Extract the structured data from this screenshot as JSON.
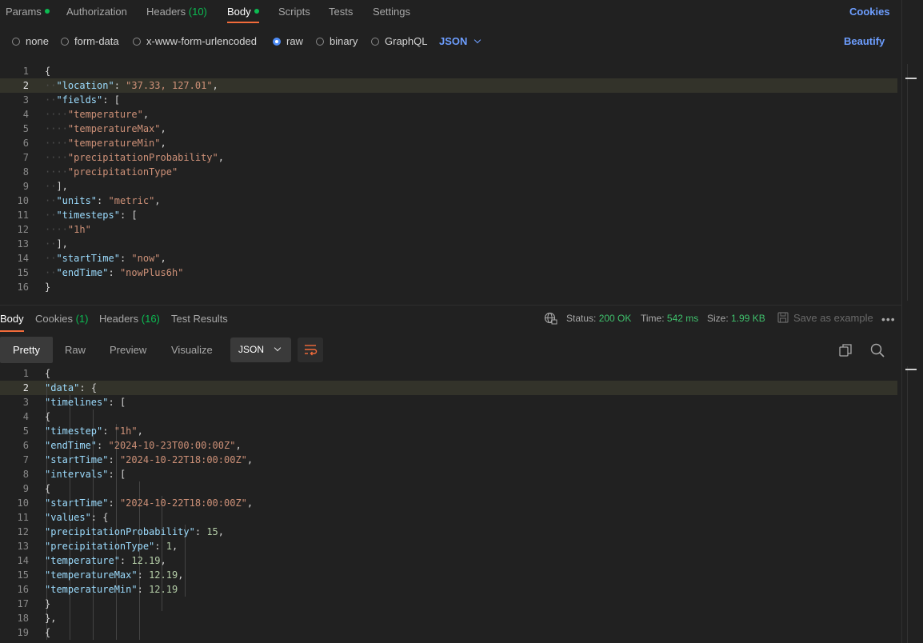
{
  "request_tabs": [
    {
      "label": "Params",
      "dot": true
    },
    {
      "label": "Authorization"
    },
    {
      "label": "Headers",
      "count": "(10)"
    },
    {
      "label": "Body",
      "dot": true,
      "active": true
    },
    {
      "label": "Scripts"
    },
    {
      "label": "Tests"
    },
    {
      "label": "Settings"
    }
  ],
  "cookies_link": "Cookies",
  "body_types": [
    "none",
    "form-data",
    "x-www-form-urlencoded",
    "raw",
    "binary",
    "GraphQL"
  ],
  "selected_body_type": "raw",
  "body_language": "JSON",
  "beautify_label": "Beautify",
  "request_body_lines": [
    "{",
    "  \"location\": \"37.33, 127.01\",",
    "  \"fields\": [",
    "    \"temperature\",",
    "    \"temperatureMax\",",
    "    \"temperatureMin\",",
    "    \"precipitationProbability\",",
    "    \"precipitationType\"",
    "  ],",
    "  \"units\": \"metric\",",
    "  \"timesteps\": [",
    "    \"1h\"",
    "  ],",
    "  \"startTime\": \"now\",",
    "  \"endTime\": \"nowPlus6h\"",
    "}"
  ],
  "request_current_line": 2,
  "response_tabs": [
    {
      "label": "Body",
      "active": true
    },
    {
      "label": "Cookies",
      "count": "(1)"
    },
    {
      "label": "Headers",
      "count": "(16)"
    },
    {
      "label": "Test Results"
    }
  ],
  "status": {
    "label": "Status:",
    "value": "200 OK"
  },
  "time": {
    "label": "Time:",
    "value": "542 ms"
  },
  "size": {
    "label": "Size:",
    "value": "1.99 KB"
  },
  "save_example_label": "Save as example",
  "view_tabs": [
    "Pretty",
    "Raw",
    "Preview",
    "Visualize"
  ],
  "active_view": "Pretty",
  "response_format": "JSON",
  "response_lines": [
    "{",
    "    \"data\": {",
    "        \"timelines\": [",
    "            {",
    "                \"timestep\": \"1h\",",
    "                \"endTime\": \"2024-10-23T00:00:00Z\",",
    "                \"startTime\": \"2024-10-22T18:00:00Z\",",
    "                \"intervals\": [",
    "                    {",
    "                        \"startTime\": \"2024-10-22T18:00:00Z\",",
    "                        \"values\": {",
    "                            \"precipitationProbability\": 15,",
    "                            \"precipitationType\": 1,",
    "                            \"temperature\": 12.19,",
    "                            \"temperatureMax\": 12.19,",
    "                            \"temperatureMin\": 12.19",
    "                        }",
    "                    },",
    "                    {"
  ],
  "response_current_line": 2
}
